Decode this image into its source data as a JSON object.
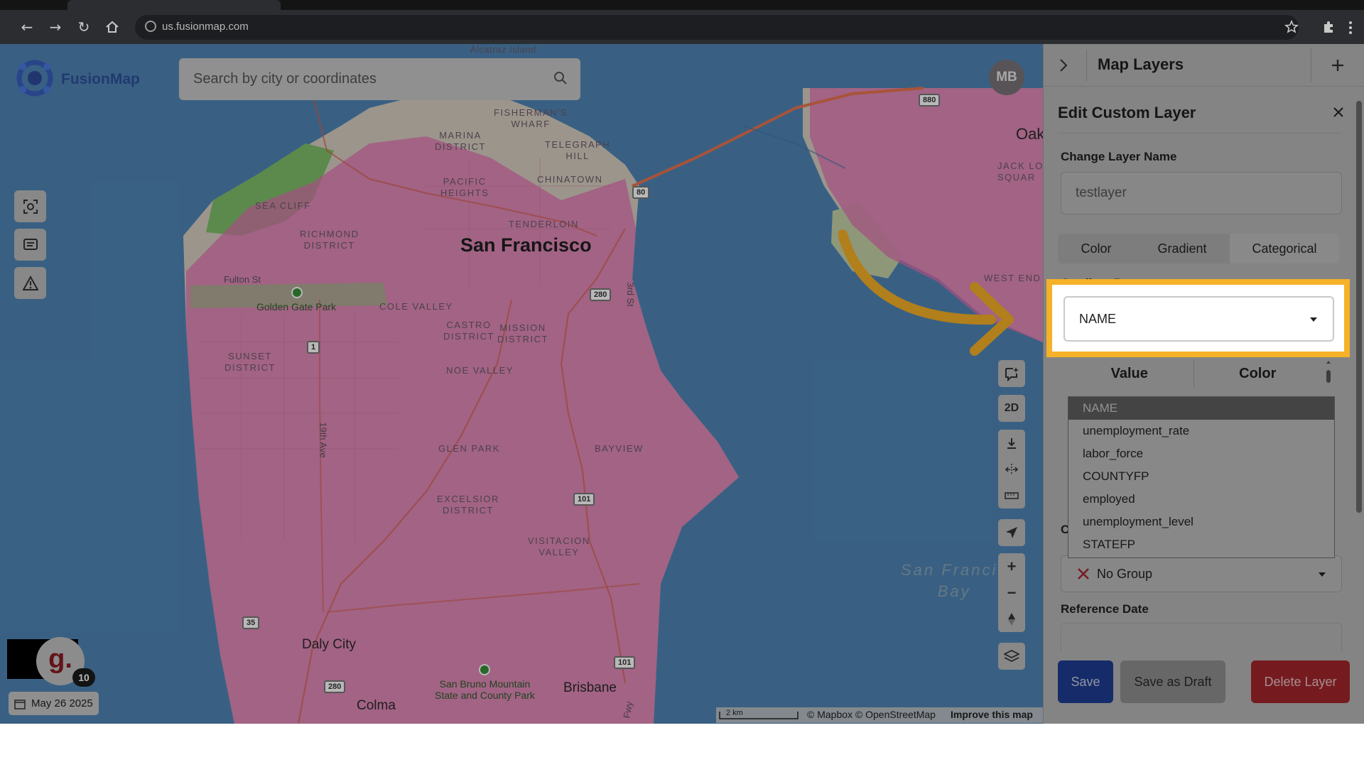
{
  "browser": {
    "url": "us.fusionmap.com",
    "back_icon": "arrow-left-icon",
    "forward_icon": "arrow-right-icon",
    "reload_icon": "reload-icon",
    "home_icon": "home-icon"
  },
  "app": {
    "logo_text": "FusionMap",
    "search_placeholder": "Search by city or coordinates",
    "avatar_initials": "MB",
    "date": "May 26 2025",
    "notification_count": "10",
    "g_badge": "g."
  },
  "map": {
    "labels": {
      "alcatraz": "Alcatraz Island",
      "fishermans_wharf": "FISHERMAN'S\nWHARF",
      "marina": "MARINA\nDISTRICT",
      "telegraph_hill": "TELEGRAPH\nHILL",
      "pacific_heights": "PACIFIC\nHEIGHTS",
      "chinatown": "CHINATOWN",
      "sea_cliff": "SEA CLIFF",
      "tenderloin": "TENDERLOIN",
      "richmond": "RICHMOND\nDISTRICT",
      "san_francisco": "San Francisco",
      "fulton_st": "Fulton St",
      "golden_gate_park": "Golden Gate Park",
      "cole_valley": "COLE VALLEY",
      "castro": "CASTRO\nDISTRICT",
      "mission": "MISSION\nDISTRICT",
      "sunset": "SUNSET\nDISTRICT",
      "noe_valley": "NOE VALLEY",
      "glen_park": "GLEN PARK",
      "bayview": "BAYVIEW",
      "excelsior": "EXCELSIOR\nDISTRICT",
      "visitacion": "VISITACION\nVALLEY",
      "daly_city": "Daly City",
      "san_bruno_park": "San Bruno Mountain\nState and County Park",
      "brisbane": "Brisbane",
      "colma": "Colma",
      "oak": "Oak",
      "jack_london": "JACK LON\nSQUAR",
      "west_end": "WEST END",
      "sf_bay": "San Francis\nBay",
      "third_st": "3rd St",
      "nineteenth_ave": "19th Ave",
      "fwy": "Fwy"
    },
    "shields": {
      "i80": "80",
      "i280_a": "280",
      "us1": "1",
      "us101_a": "101",
      "i35": "35",
      "i280_b": "280",
      "us101_b": "101",
      "i880": "880"
    },
    "controls": {
      "mode": "2D"
    },
    "attribution": {
      "scale": "2 km",
      "credits": "© Mapbox © OpenStreetMap",
      "improve": "Improve this map",
      "mapbox": "mapbox"
    },
    "colors": {
      "water": "#4f86b6",
      "land": "#d9cfc2",
      "overlay": "#e36fb4",
      "park": "#7fbf6a"
    }
  },
  "panel": {
    "title": "Map Layers",
    "edit_title": "Edit Custom Layer",
    "change_name_label": "Change Layer Name",
    "layer_name_value": "testlayer",
    "tabs": [
      "Color",
      "Gradient",
      "Categorical"
    ],
    "selected_tab": "Categorical",
    "property_label": "Gradient Property",
    "property_value": "NAME",
    "table_headers": [
      "Value",
      "Color"
    ],
    "dropdown_options": [
      "NAME",
      "unemployment_rate",
      "labor_force",
      "COUNTYFP",
      "employed",
      "unemployment_level",
      "STATEFP"
    ],
    "hidden_label_initial": "C",
    "group_value": "No Group",
    "reference_date_label": "Reference Date",
    "buttons": {
      "save": "Save",
      "draft": "Save as Draft",
      "delete": "Delete Layer"
    },
    "highlight_color": "#f6b128"
  }
}
